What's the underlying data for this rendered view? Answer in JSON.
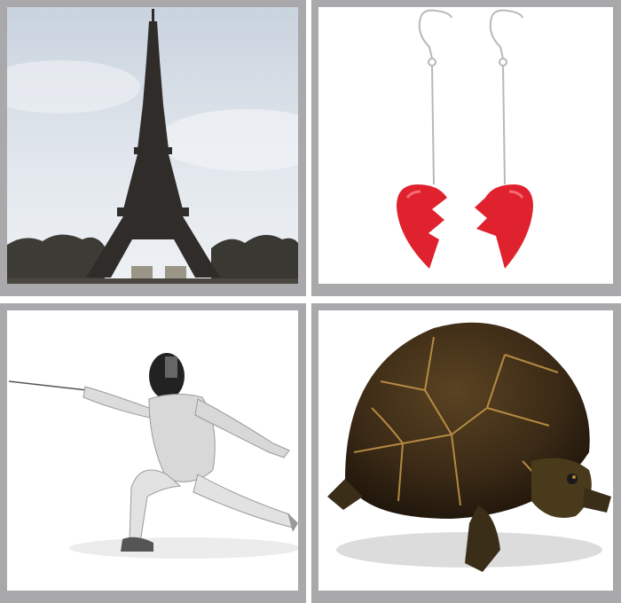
{
  "puzzle": {
    "tiles": [
      {
        "subject": "eiffel-tower"
      },
      {
        "subject": "broken-heart-earrings"
      },
      {
        "subject": "fencer"
      },
      {
        "subject": "box-turtle"
      }
    ]
  },
  "colors": {
    "frame": "#a9a9ab",
    "sky": "#dde4ec",
    "heart": "#e0222e",
    "turtle_shell": "#3b2a16"
  }
}
